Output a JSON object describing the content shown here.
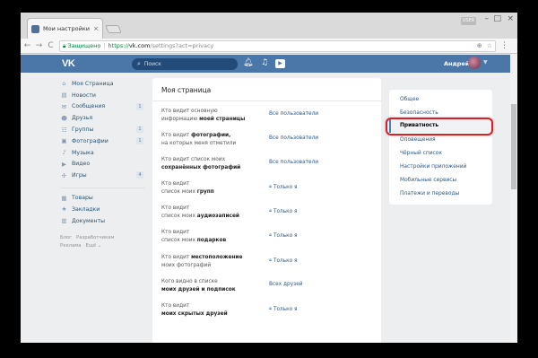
{
  "browser": {
    "tab_title": "Мои настройки",
    "tab_close": "×",
    "user_badge": "USER",
    "win_min": "–",
    "win_max": "□",
    "win_close": "×",
    "back": "←",
    "forward": "→",
    "reload": "C",
    "secure_label": "Защищено",
    "url_scheme": "https://",
    "url_host": "vk.com",
    "url_path": "/settings?act=privacy",
    "menu": "⋮"
  },
  "vk": {
    "logo": "VK",
    "search_placeholder": "Поиск",
    "user_name": "Андрей",
    "play_icon": "▶"
  },
  "leftnav": {
    "items": [
      {
        "label": "Моя Страница",
        "icon": "home-icon",
        "glyph": "⌂",
        "count": ""
      },
      {
        "label": "Новости",
        "icon": "news-icon",
        "glyph": "▤",
        "count": ""
      },
      {
        "label": "Сообщения",
        "icon": "messages-icon",
        "glyph": "✉",
        "count": "1"
      },
      {
        "label": "Друзья",
        "icon": "friends-icon",
        "glyph": "☻",
        "count": ""
      },
      {
        "label": "Группы",
        "icon": "groups-icon",
        "glyph": "☷",
        "count": "1"
      },
      {
        "label": "Фотографии",
        "icon": "photos-icon",
        "glyph": "▣",
        "count": "1"
      },
      {
        "label": "Музыка",
        "icon": "music-icon",
        "glyph": "♪",
        "count": ""
      },
      {
        "label": "Видео",
        "icon": "video-icon",
        "glyph": "▶",
        "count": ""
      },
      {
        "label": "Игры",
        "icon": "games-icon",
        "glyph": "✣",
        "count": "4"
      }
    ],
    "items2": [
      {
        "label": "Товары",
        "icon": "goods-icon",
        "glyph": "▦"
      },
      {
        "label": "Закладки",
        "icon": "bookmarks-icon",
        "glyph": "★"
      },
      {
        "label": "Документы",
        "icon": "documents-icon",
        "glyph": "▥"
      }
    ],
    "footer": [
      "Блог",
      "Разработчикам",
      "Реклама",
      "Ещё ⌄"
    ]
  },
  "main": {
    "title": "Моя страница",
    "rows": [
      {
        "q1": "Кто видит основную",
        "q2": "информацию ",
        "q2b": "моей страницы",
        "value": "Все пользователи",
        "locked": false
      },
      {
        "q1": "Кто видит ",
        "q1b": "фотографии,",
        "q2": "на которых меня отметили",
        "value": "Все пользователи",
        "locked": false
      },
      {
        "q1": "Кто видит список моих",
        "q2": "",
        "q2b": "сохранённых фотографий",
        "value": "Все пользователи",
        "locked": false
      },
      {
        "q1": "Кто видит",
        "q2": "список моих ",
        "q2b": "групп",
        "value": "Только я",
        "locked": true
      },
      {
        "q1": "Кто видит",
        "q2": "список моих ",
        "q2b": "аудиозаписей",
        "value": "Только я",
        "locked": true
      },
      {
        "q1": "Кто видит",
        "q2": "список моих ",
        "q2b": "подарков",
        "value": "Только я",
        "locked": true
      },
      {
        "q1": "Кто видит ",
        "q1b": "местоположение",
        "q2": "моих фотографий",
        "value": "Только я",
        "locked": true
      },
      {
        "q1": "Кого видно в списке",
        "q2": "",
        "q2b": "моих друзей и подписок",
        "value": "Всех друзей",
        "locked": false
      },
      {
        "q1": "Кто видит",
        "q2": "",
        "q2b": "моих скрытых друзей",
        "value": "Только я",
        "locked": true
      }
    ]
  },
  "settings_menu": {
    "items": [
      "Общее",
      "Безопасность",
      "Приватность",
      "Оповещения",
      "Чёрный список",
      "Настройки приложений",
      "Мобильные сервисы",
      "Платежи и переводы"
    ],
    "active_index": 2
  },
  "colors": {
    "header": "#4a76a8",
    "link": "#2a5885",
    "highlight": "#d2232a"
  }
}
